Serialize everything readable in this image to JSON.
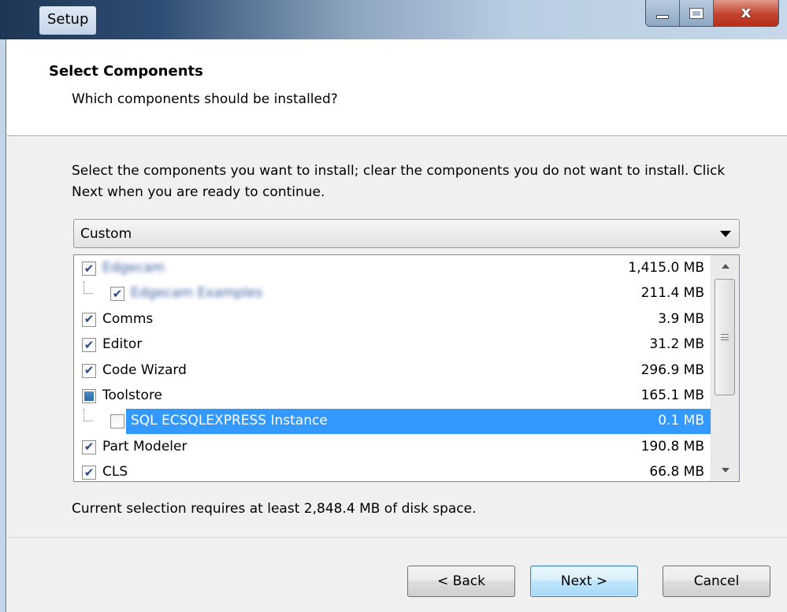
{
  "window": {
    "title": "Setup"
  },
  "header": {
    "title": "Select Components",
    "subtitle": "Which components should be installed?"
  },
  "main": {
    "description": "Select the components you want to install; clear the components you do not want to install. Click Next when you are ready to continue.",
    "setup_type": {
      "selected": "Custom"
    },
    "components": [
      {
        "label": "Edgecam",
        "size": "1,415.0 MB",
        "state": "checked",
        "indent": 0,
        "blurred": true
      },
      {
        "label": "Edgecam Examples",
        "size": "211.4 MB",
        "state": "checked",
        "indent": 1,
        "blurred": true
      },
      {
        "label": "Comms",
        "size": "3.9 MB",
        "state": "checked",
        "indent": 0
      },
      {
        "label": "Editor",
        "size": "31.2 MB",
        "state": "checked",
        "indent": 0
      },
      {
        "label": "Code Wizard",
        "size": "296.9 MB",
        "state": "checked",
        "indent": 0
      },
      {
        "label": "Toolstore",
        "size": "165.1 MB",
        "state": "partial",
        "indent": 0
      },
      {
        "label": "SQL ECSQLEXPRESS Instance",
        "size": "0.1 MB",
        "state": "unchecked",
        "indent": 1,
        "selected": true
      },
      {
        "label": "Part Modeler",
        "size": "190.8 MB",
        "state": "checked",
        "indent": 0
      },
      {
        "label": "CLS",
        "size": "66.8 MB",
        "state": "checked",
        "indent": 0
      }
    ],
    "disk_space_text": "Current selection requires at least 2,848.4 MB of disk space."
  },
  "footer": {
    "back_label": "< Back",
    "next_label": "Next >",
    "cancel_label": "Cancel"
  },
  "colors": {
    "selection": "#3399ff",
    "checkmark": "#2a4a8c"
  },
  "icons": {
    "check": "check-icon",
    "close": "close-icon",
    "dropdown": "chevron-down-icon"
  }
}
